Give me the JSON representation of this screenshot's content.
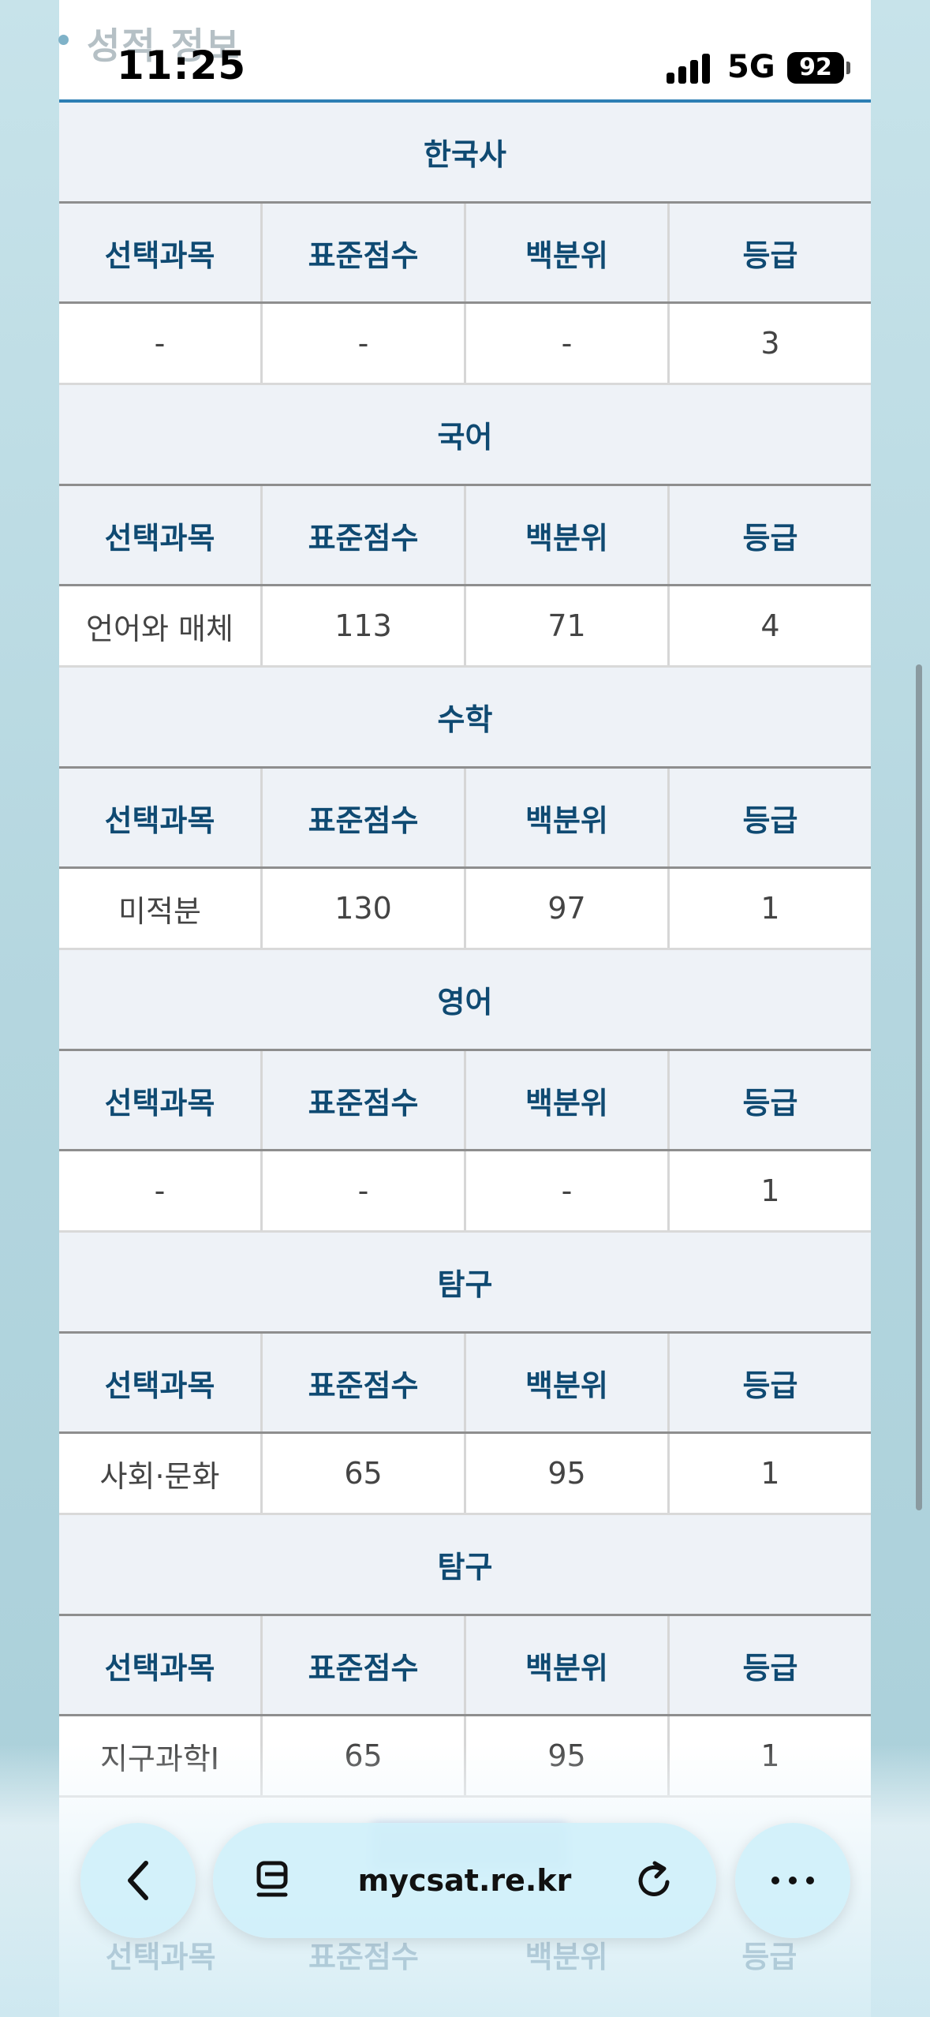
{
  "status_bar": {
    "section_ghost": "성적 정보",
    "time": "11:25",
    "network": "5G",
    "battery": "92"
  },
  "subjects": [
    {
      "title": "한국사",
      "headers": [
        "선택과목",
        "표준점수",
        "백분위",
        "등급"
      ],
      "values": [
        "-",
        "-",
        "-",
        "3"
      ]
    },
    {
      "title": "국어",
      "headers": [
        "선택과목",
        "표준점수",
        "백분위",
        "등급"
      ],
      "values": [
        "언어와 매체",
        "113",
        "71",
        "4"
      ]
    },
    {
      "title": "수학",
      "headers": [
        "선택과목",
        "표준점수",
        "백분위",
        "등급"
      ],
      "values": [
        "미적분",
        "130",
        "97",
        "1"
      ]
    },
    {
      "title": "영어",
      "headers": [
        "선택과목",
        "표준점수",
        "백분위",
        "등급"
      ],
      "values": [
        "-",
        "-",
        "-",
        "1"
      ]
    },
    {
      "title": "탐구",
      "headers": [
        "선택과목",
        "표준점수",
        "백분위",
        "등급"
      ],
      "values": [
        "사회·문화",
        "65",
        "95",
        "1"
      ]
    },
    {
      "title": "탐구",
      "headers": [
        "선택과목",
        "표준점수",
        "백분위",
        "등급"
      ],
      "values": [
        "지구과학I",
        "65",
        "95",
        "1"
      ]
    }
  ],
  "ghost_headers": [
    "선택과목",
    "표준점수",
    "백분위",
    "등급"
  ],
  "browser": {
    "url": "mycsat.re.kr",
    "back_icon": "chevron-left-icon",
    "tabs_icon": "reader-icon",
    "reload_icon": "reload-icon",
    "more_icon": "ellipsis-icon"
  },
  "colors": {
    "header_text": "#0f4a72",
    "header_bg": "#eef2f7",
    "accent_line": "#2d7fb4"
  }
}
